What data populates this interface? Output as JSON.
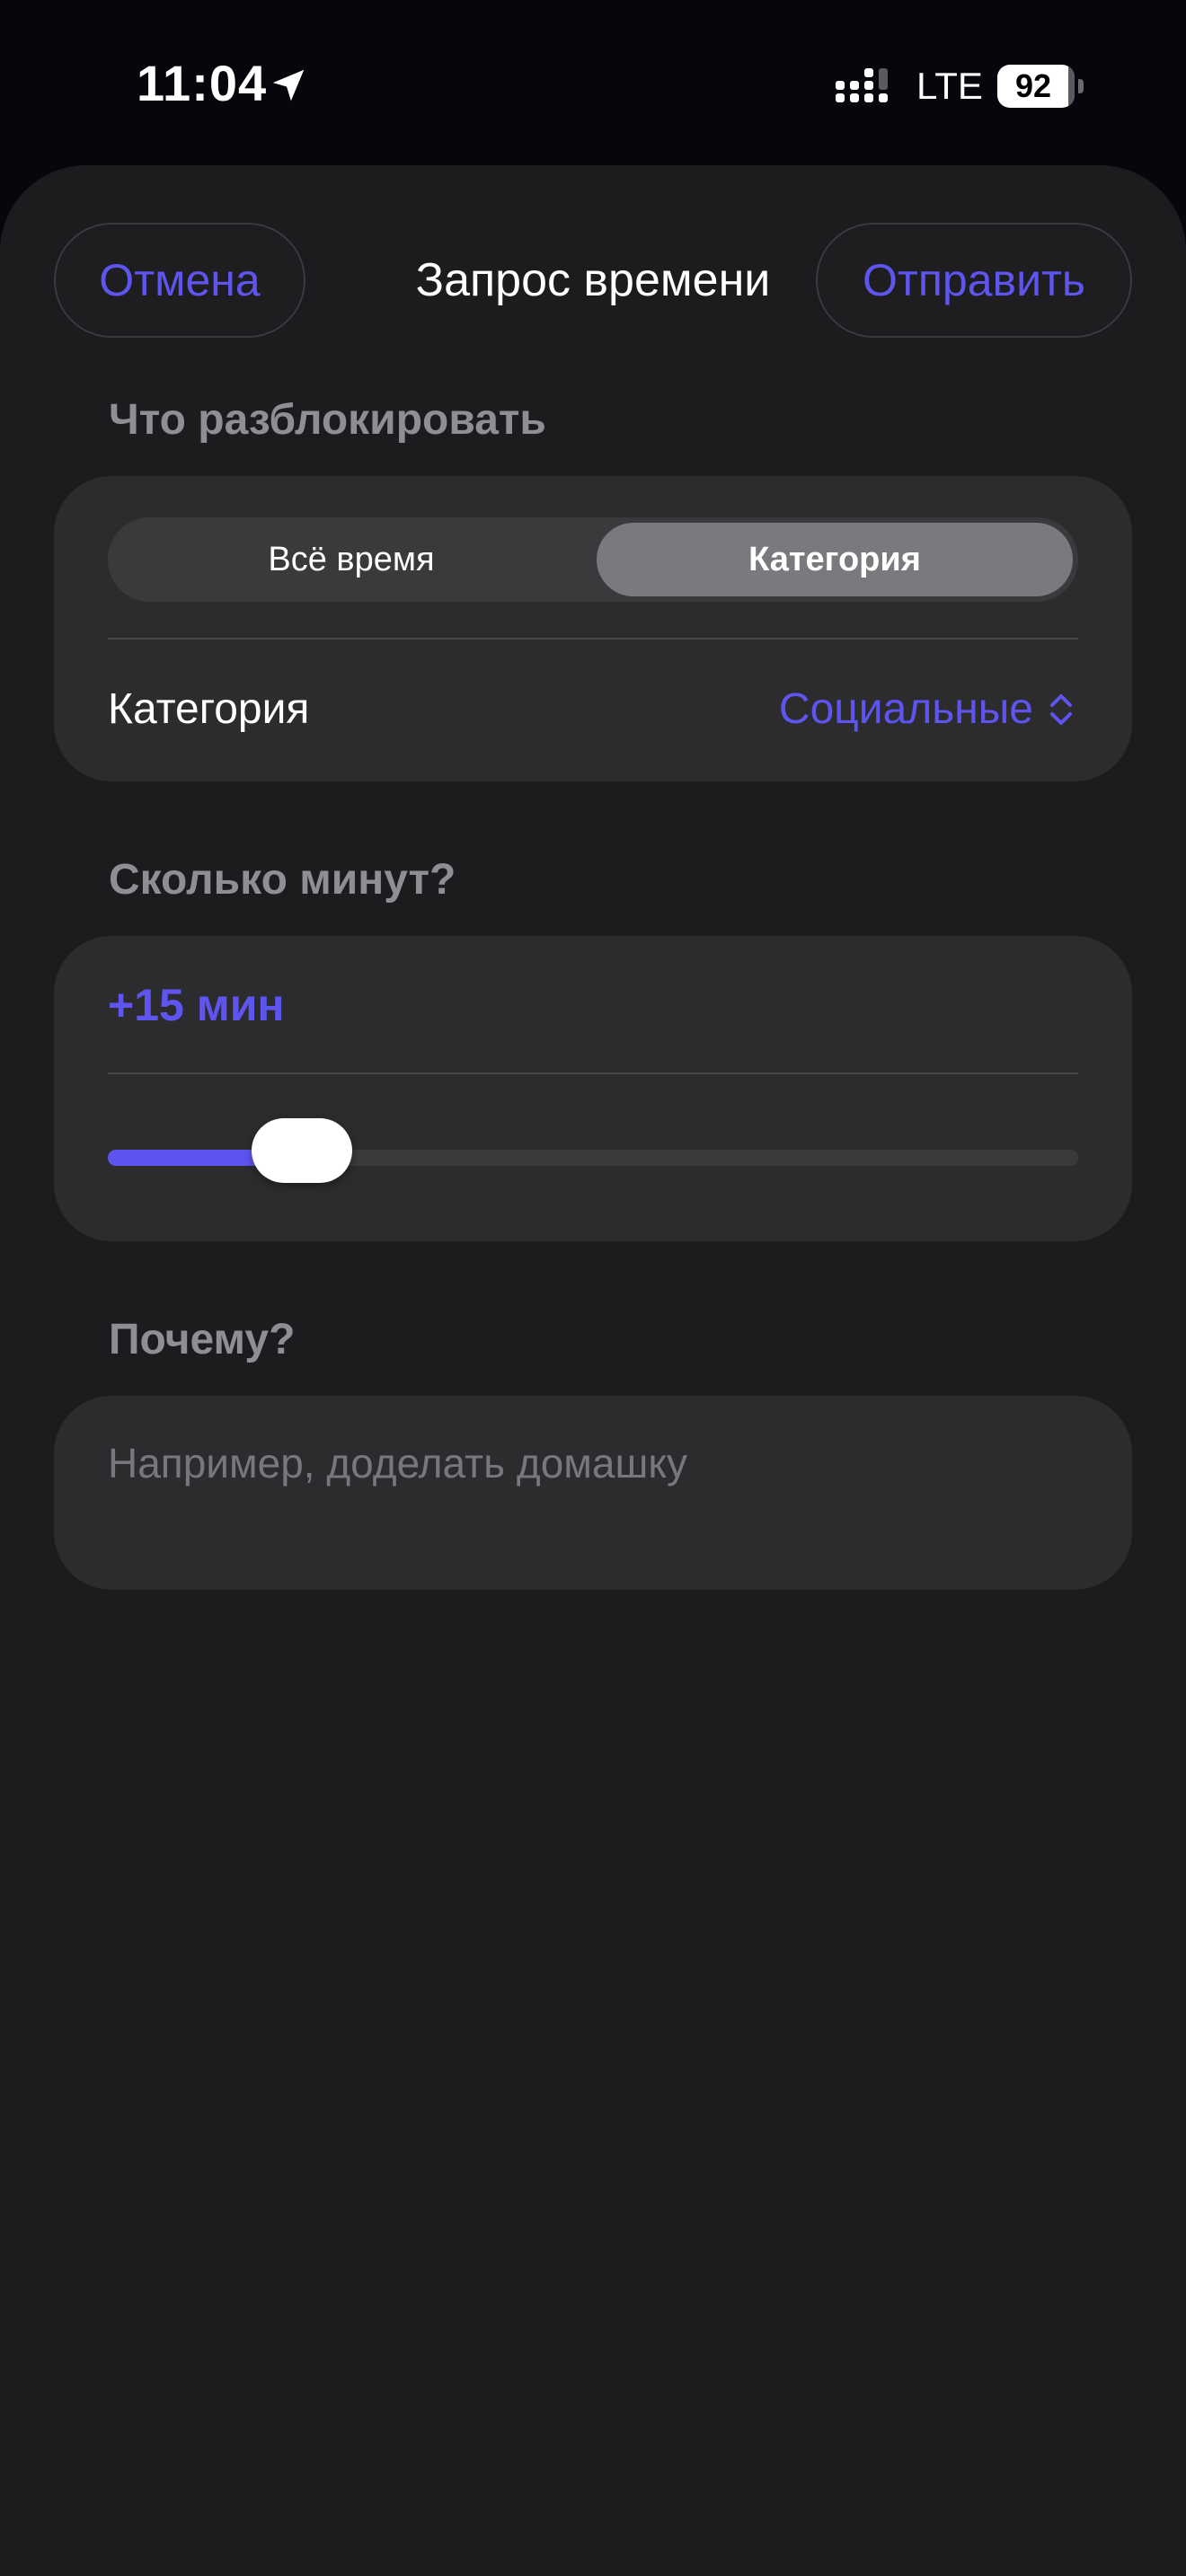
{
  "status_bar": {
    "time": "11:04",
    "network": "LTE",
    "battery": "92",
    "battery_level": 0.92
  },
  "header": {
    "cancel_label": "Отмена",
    "title": "Запрос времени",
    "send_label": "Отправить"
  },
  "unlock_section": {
    "header": "Что разблокировать",
    "segments": [
      "Всё время",
      "Категория"
    ],
    "selected_segment": "Категория",
    "category_label": "Категория",
    "category_value": "Социальные"
  },
  "minutes_section": {
    "header": "Сколько минут?",
    "value_label": "+15 мин",
    "slider_fraction": 0.2
  },
  "reason_section": {
    "header": "Почему?",
    "placeholder": "Например, доделать домашку",
    "value": ""
  },
  "colors": {
    "accent": "#5e55f0",
    "sheet_background": "#1c1c1e",
    "card_background": "#2c2c2e"
  }
}
